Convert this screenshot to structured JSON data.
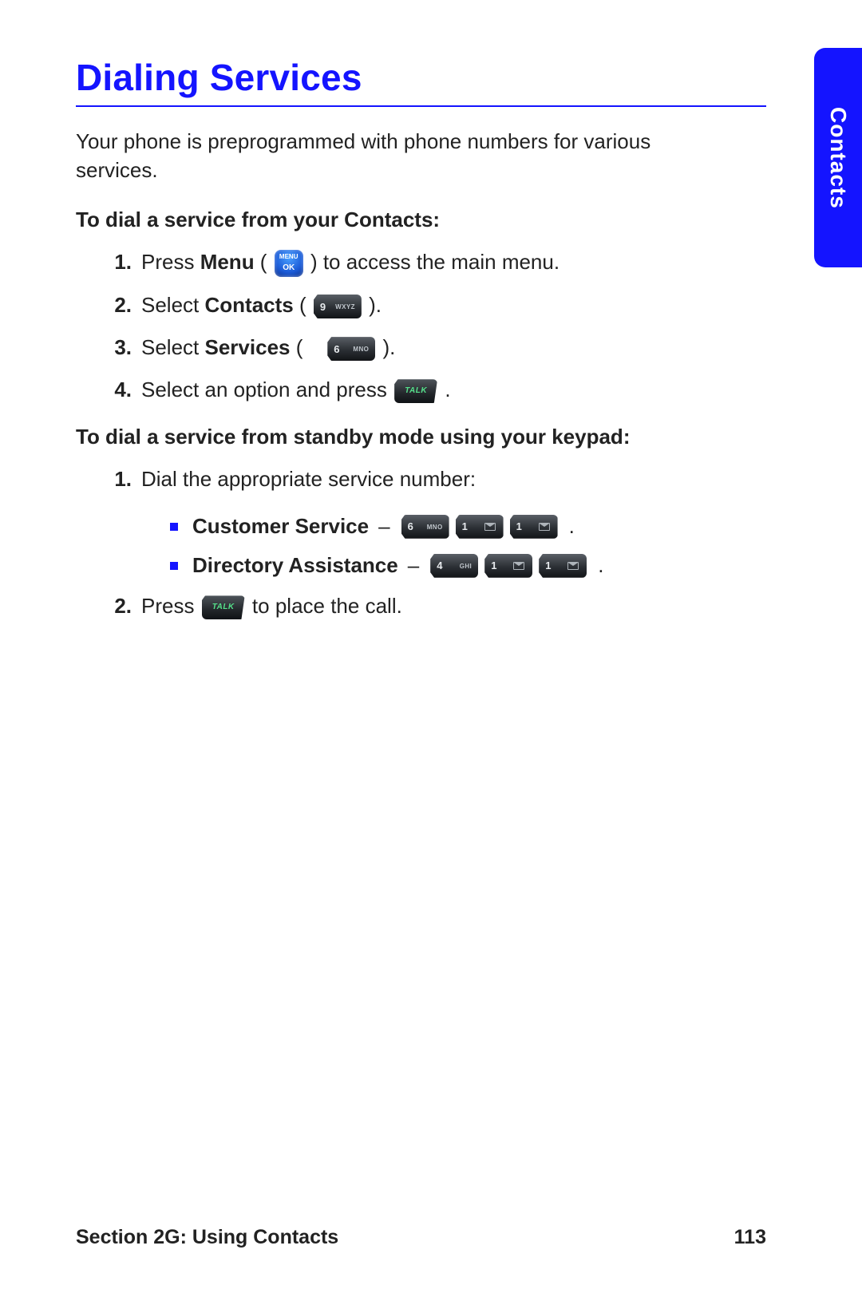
{
  "tab_label": "Contacts",
  "title": "Dialing Services",
  "intro": "Your phone is preprogrammed with phone numbers for various services.",
  "sub1": "To dial a service from your Contacts:",
  "steps1": {
    "s1a": "Press ",
    "s1b": "Menu",
    "s1c": " (",
    "s1d": ") to access the main menu.",
    "s2a": "Select ",
    "s2b": "Contacts",
    "s2c": " (",
    "s2d": ").",
    "s3a": "Select ",
    "s3b": "Services",
    "s3c": " (",
    "s3d": ").",
    "s4a": "Select an option and press ",
    "s4b": "."
  },
  "sub2": "To dial a service from standby mode using your keypad:",
  "steps2": {
    "s1": "Dial the appropriate service number:",
    "cs_label": "Customer Service",
    "da_label": "Directory Assistance",
    "dash": " – ",
    "period": ".",
    "s2a": "Press ",
    "s2b": " to place the call."
  },
  "keys": {
    "menu_top": "MENU",
    "menu_ok": "OK",
    "k9_d": "9",
    "k9_t": "WXYZ",
    "k6_d": "6",
    "k6_t": "MNO",
    "k4_d": "4",
    "k4_t": "GHI",
    "k1_d": "1"
  },
  "footer_left": "Section 2G: Using Contacts",
  "footer_right": "113"
}
